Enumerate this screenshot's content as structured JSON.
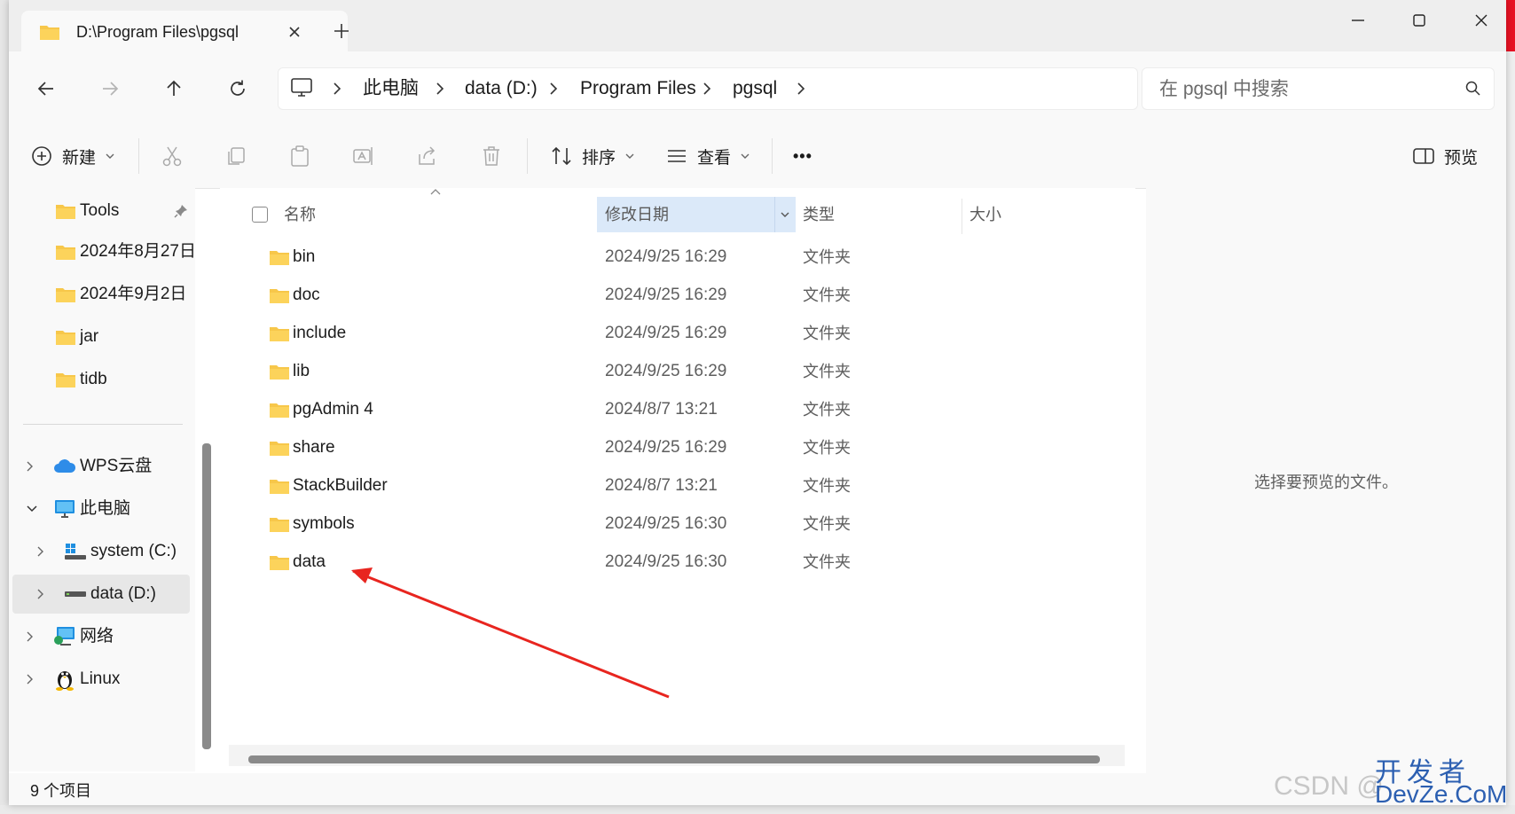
{
  "window": {
    "tab_title": "D:\\Program Files\\pgsql",
    "new_tab_icon": "plus-icon",
    "buttons": [
      "minimize-icon",
      "maximize-icon",
      "close-icon"
    ]
  },
  "navigation": {
    "icons": [
      "back-arrow-icon",
      "forward-arrow-icon",
      "up-arrow-icon",
      "refresh-icon",
      "computer-icon"
    ],
    "breadcrumbs": [
      "此电脑",
      "data (D:)",
      "Program Files",
      "pgsql"
    ],
    "search_placeholder": "在 pgsql 中搜索"
  },
  "command_bar": {
    "new_label": "新建",
    "sort_label": "排序",
    "view_label": "查看",
    "more_label": "•••",
    "preview_label": "预览"
  },
  "sidebar": {
    "quick_access": [
      {
        "label": "Tools",
        "pinned": true
      },
      {
        "label": "2024年8月27日"
      },
      {
        "label": "2024年9月2日"
      },
      {
        "label": "jar"
      },
      {
        "label": "tidb"
      }
    ],
    "tree": [
      {
        "label": "WPS云盘",
        "icon": "cloud-icon",
        "expanded": false
      },
      {
        "label": "此电脑",
        "icon": "computer-icon",
        "expanded": true
      },
      {
        "label": "system (C:)",
        "icon": "windows-drive-icon",
        "expanded": false
      },
      {
        "label": "data (D:)",
        "icon": "drive-icon",
        "expanded": false,
        "selected": true
      },
      {
        "label": "网络",
        "icon": "network-icon",
        "expanded": false
      },
      {
        "label": "Linux",
        "icon": "linux-penguin-icon",
        "expanded": false
      }
    ]
  },
  "file_list": {
    "columns": {
      "name": "名称",
      "date": "修改日期",
      "type": "类型",
      "size": "大小"
    },
    "sorted_column": "修改日期",
    "rows": [
      {
        "name": "bin",
        "date": "2024/9/25 16:29",
        "type": "文件夹"
      },
      {
        "name": "doc",
        "date": "2024/9/25 16:29",
        "type": "文件夹"
      },
      {
        "name": "include",
        "date": "2024/9/25 16:29",
        "type": "文件夹"
      },
      {
        "name": "lib",
        "date": "2024/9/25 16:29",
        "type": "文件夹"
      },
      {
        "name": "pgAdmin 4",
        "date": "2024/8/7 13:21",
        "type": "文件夹"
      },
      {
        "name": "share",
        "date": "2024/9/25 16:29",
        "type": "文件夹"
      },
      {
        "name": "StackBuilder",
        "date": "2024/8/7 13:21",
        "type": "文件夹"
      },
      {
        "name": "symbols",
        "date": "2024/9/25 16:30",
        "type": "文件夹"
      },
      {
        "name": "data",
        "date": "2024/9/25 16:30",
        "type": "文件夹"
      }
    ]
  },
  "preview_pane": {
    "message": "选择要预览的文件。"
  },
  "status": {
    "item_count": "9 个项目"
  },
  "annotation": {
    "arrow_color": "#e8251f",
    "points_to": "data"
  },
  "colors": {
    "folder": "#f7c74a",
    "sorted_header": "#dbe9f9",
    "selection": "#e7e7e7"
  },
  "watermark": {
    "csdn": "CSDN @",
    "site_cn": "开发者",
    "site_en": "DevZe.CoM"
  }
}
